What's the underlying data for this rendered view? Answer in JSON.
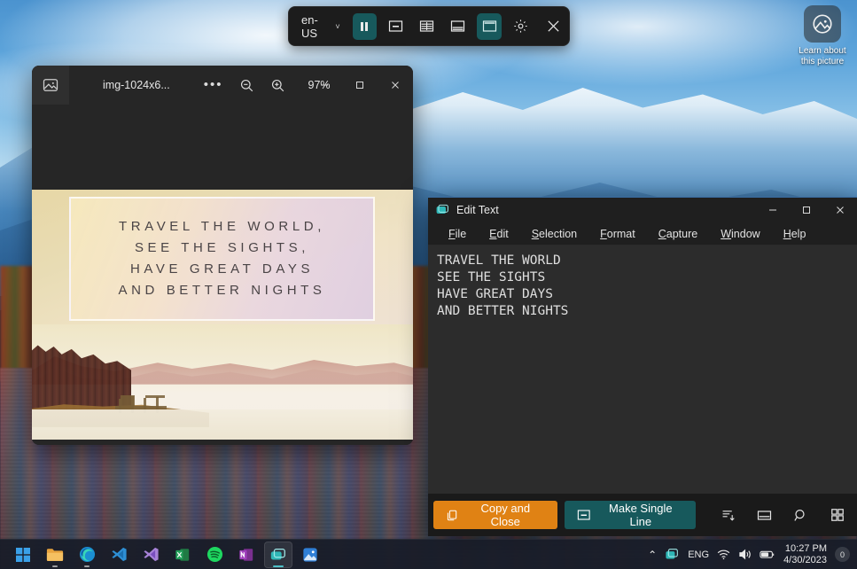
{
  "desktop": {
    "icon": {
      "name": "picture-icon",
      "label_line1": "Learn about",
      "label_line2": "this picture"
    }
  },
  "capture_toolbar": {
    "language": "en-US",
    "chevron": "˅",
    "buttons": [
      {
        "name": "pause-button",
        "label": "Pause",
        "icon": "pause-icon",
        "active": true
      },
      {
        "name": "single-line-button",
        "label": "Single Line",
        "icon": "single-line-icon",
        "active": false
      },
      {
        "name": "table-capture-button",
        "label": "Table Capture",
        "icon": "table-icon",
        "active": false
      },
      {
        "name": "bottom-panel-button",
        "label": "Bottom Panel",
        "icon": "panel-bottom-icon",
        "active": false
      },
      {
        "name": "top-panel-button",
        "label": "Top Panel",
        "icon": "panel-top-icon",
        "active": true
      },
      {
        "name": "settings-button",
        "label": "Settings",
        "icon": "gear-icon",
        "active": false
      },
      {
        "name": "close-button",
        "label": "Close",
        "icon": "close-icon",
        "active": false
      }
    ]
  },
  "viewer": {
    "filename": "img-1024x6...",
    "more_label": "•••",
    "zoom_value": "97%",
    "zoom_out_label": "Zoom out",
    "zoom_in_label": "Zoom in",
    "minimize_label": "─",
    "maximize_label": "□",
    "close_label": "✕",
    "poster": {
      "lines": [
        "TRAVEL THE WORLD,",
        "SEE THE SIGHTS,",
        "HAVE GREAT DAYS",
        "AND BETTER NIGHTS"
      ]
    }
  },
  "edit_text": {
    "title": "Edit Text",
    "minimize_label": "─",
    "maximize_label": "□",
    "close_label": "✕",
    "menus": [
      {
        "name": "menu-file",
        "pre": "",
        "key": "F",
        "post": "ile"
      },
      {
        "name": "menu-edit",
        "pre": "",
        "key": "E",
        "post": "dit"
      },
      {
        "name": "menu-selection",
        "pre": "",
        "key": "S",
        "post": "election"
      },
      {
        "name": "menu-format",
        "pre": "",
        "key": "F",
        "post": "ormat"
      },
      {
        "name": "menu-capture",
        "pre": "",
        "key": "C",
        "post": "apture"
      },
      {
        "name": "menu-window",
        "pre": "",
        "key": "W",
        "post": "indow"
      },
      {
        "name": "menu-help",
        "pre": "",
        "key": "H",
        "post": "elp"
      }
    ],
    "content": "TRAVEL THE WORLD\nSEE THE SIGHTS\nHAVE GREAT DAYS\nAND BETTER NIGHTS",
    "buttons": {
      "copy_and_close": "Copy and Close",
      "make_single_line": "Make Single Line"
    },
    "icon_buttons": [
      {
        "name": "insert-text-icon",
        "label": "Append Text"
      },
      {
        "name": "panel-bottom-icon",
        "label": "Panel"
      },
      {
        "name": "search-icon",
        "label": "Search"
      },
      {
        "name": "qr-grid-icon",
        "label": "QR Code"
      }
    ]
  },
  "taskbar": {
    "apps": [
      {
        "name": "taskbar-start",
        "label": "Start",
        "running": false,
        "focused": false
      },
      {
        "name": "taskbar-file-explorer",
        "label": "File Explorer",
        "running": true,
        "focused": false
      },
      {
        "name": "taskbar-edge",
        "label": "Microsoft Edge",
        "running": true,
        "focused": false
      },
      {
        "name": "taskbar-vscode",
        "label": "Visual Studio Code",
        "running": false,
        "focused": false
      },
      {
        "name": "taskbar-visual-studio",
        "label": "Visual Studio",
        "running": false,
        "focused": false
      },
      {
        "name": "taskbar-excel",
        "label": "Excel",
        "running": false,
        "focused": false
      },
      {
        "name": "taskbar-spotify",
        "label": "Spotify",
        "running": false,
        "focused": false
      },
      {
        "name": "taskbar-onenote",
        "label": "OneNote",
        "running": false,
        "focused": false
      },
      {
        "name": "taskbar-text-capture",
        "label": "Text Capture",
        "running": true,
        "focused": true
      },
      {
        "name": "taskbar-photos",
        "label": "Photos",
        "running": false,
        "focused": false
      }
    ],
    "tray": {
      "chevron": "⌃",
      "app_icon": "capture-tray-icon",
      "language": "ENG",
      "wifi_icon": "wifi-icon",
      "volume_icon": "volume-icon",
      "battery_icon": "battery-icon",
      "time": "10:27 PM",
      "date": "4/30/2023",
      "notification_count": "0"
    }
  },
  "colors": {
    "accent_teal": "#17595c",
    "accent_orange": "#e08214",
    "toolbar_bg": "#1c1c1c",
    "window_bg": "#1f1f1f",
    "editor_bg": "#2c2c2c"
  }
}
